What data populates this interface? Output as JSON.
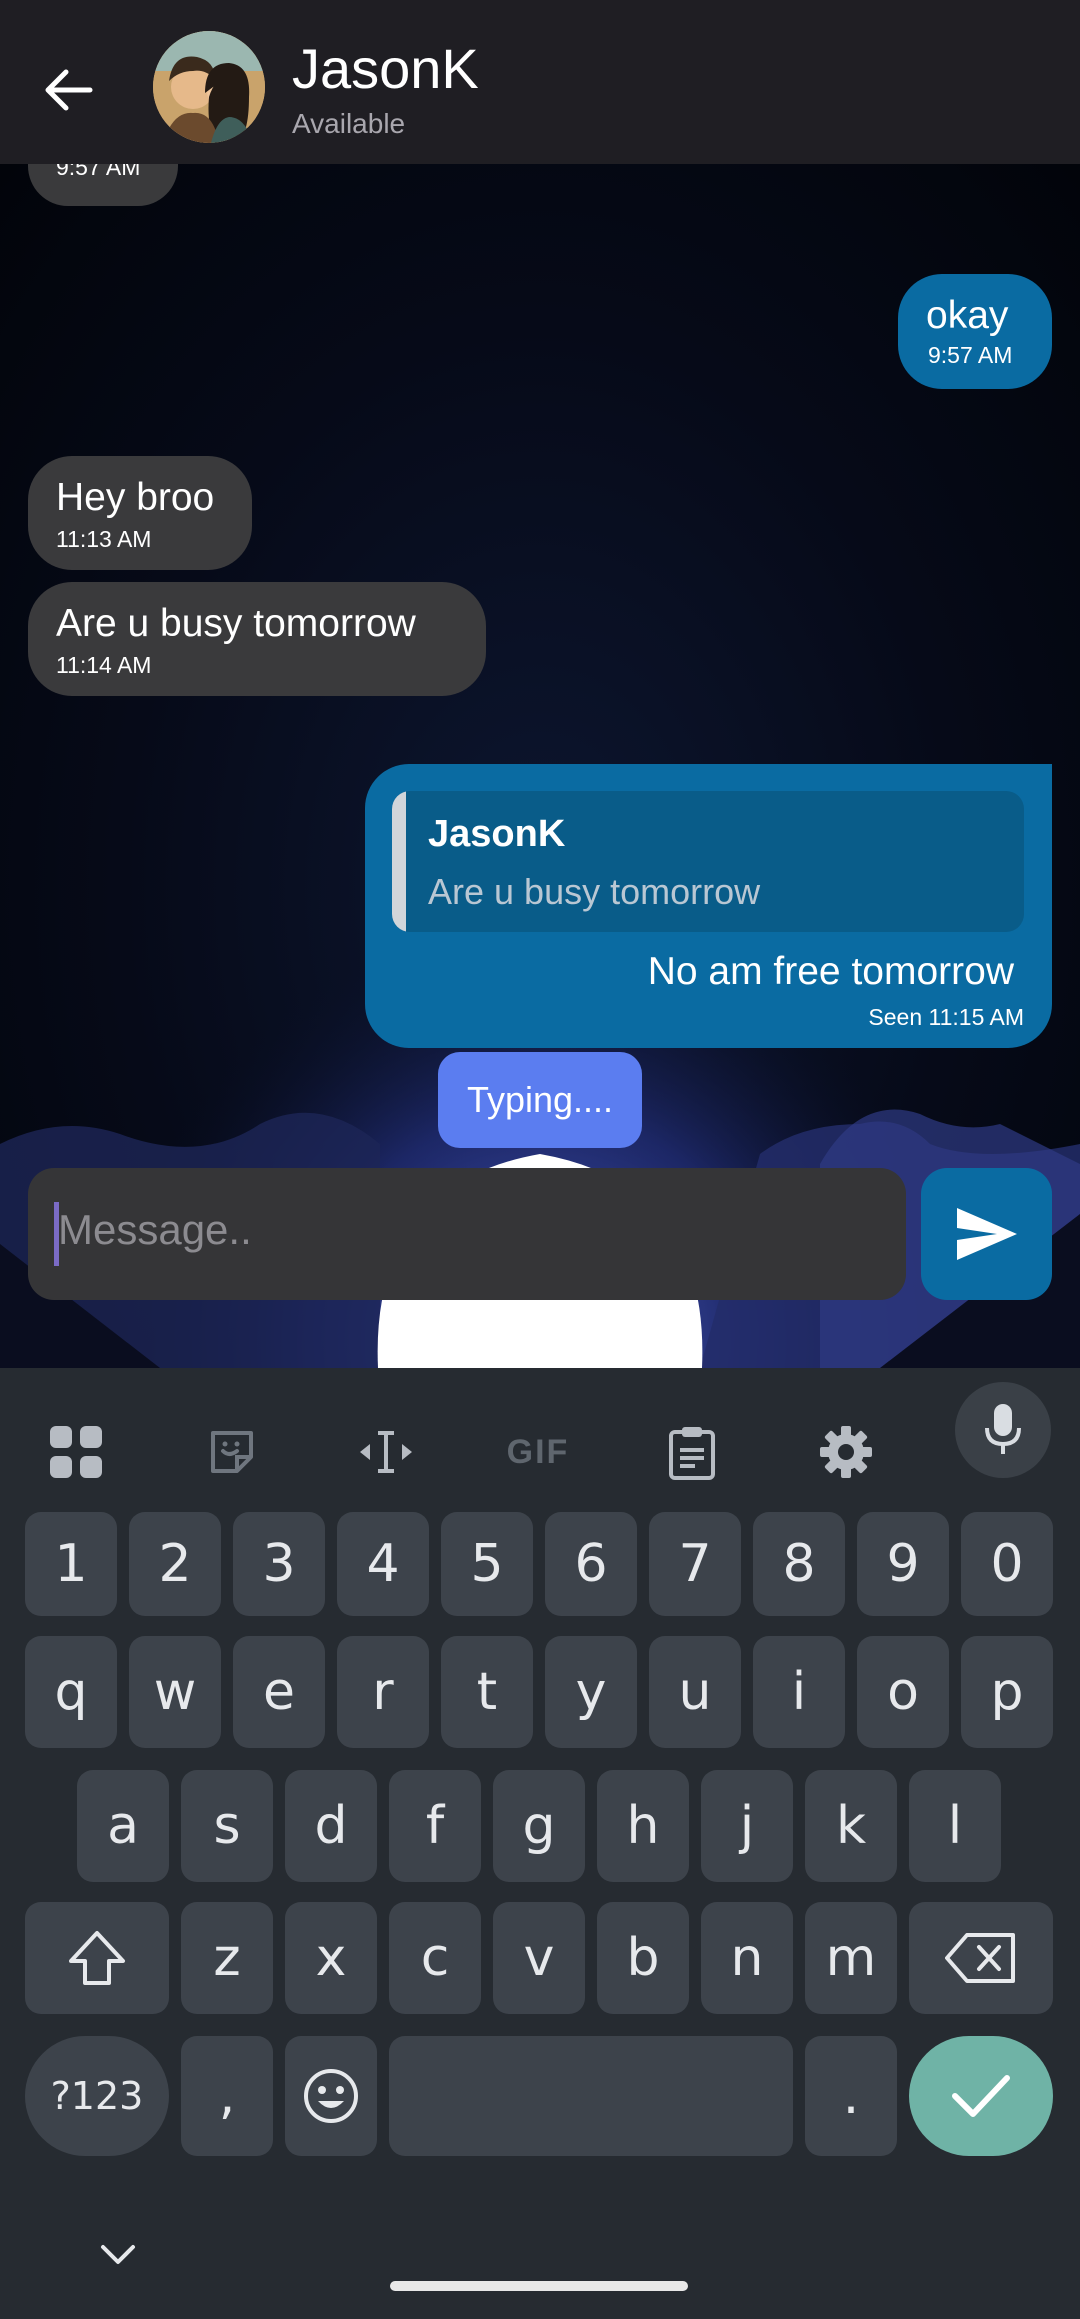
{
  "header": {
    "contact_name": "JasonK",
    "status": "Available"
  },
  "messages": {
    "partial_time": "9:57 AM",
    "okay": {
      "text": "okay",
      "time": "9:57 AM"
    },
    "hey": {
      "text": "Hey broo",
      "time": "11:13 AM"
    },
    "busy": {
      "text": "Are u busy tomorrow",
      "time": "11:14 AM"
    },
    "reply": {
      "quoted_name": "JasonK",
      "quoted_text": "Are u busy tomorrow",
      "text": "No am free tomorrow",
      "time": "Seen 11:15 AM"
    }
  },
  "typing_label": "Typing....",
  "composer": {
    "placeholder": "Message.."
  },
  "keyboard": {
    "tools": [
      "apps-grid-icon",
      "sticker-icon",
      "text-cursor-icon",
      "gif-icon",
      "clipboard-icon",
      "gear-icon",
      "microphone-icon"
    ],
    "gif_label": "GIF",
    "row_numbers": [
      "1",
      "2",
      "3",
      "4",
      "5",
      "6",
      "7",
      "8",
      "9",
      "0"
    ],
    "row_q": [
      "q",
      "w",
      "e",
      "r",
      "t",
      "y",
      "u",
      "i",
      "o",
      "p"
    ],
    "row_a": [
      "a",
      "s",
      "d",
      "f",
      "g",
      "h",
      "j",
      "k",
      "l"
    ],
    "row_z": [
      "z",
      "x",
      "c",
      "v",
      "b",
      "n",
      "m"
    ],
    "symbols_label": "?123",
    "comma": ",",
    "period": "."
  },
  "colors": {
    "header_bg": "#1f1e23",
    "incoming_bubble": "#3a3a3c",
    "outgoing_bubble": "#0a6ba2",
    "typing_bubble": "#5b7df0",
    "keyboard_bg": "#262b31",
    "enter_key": "#6fb3a6"
  }
}
